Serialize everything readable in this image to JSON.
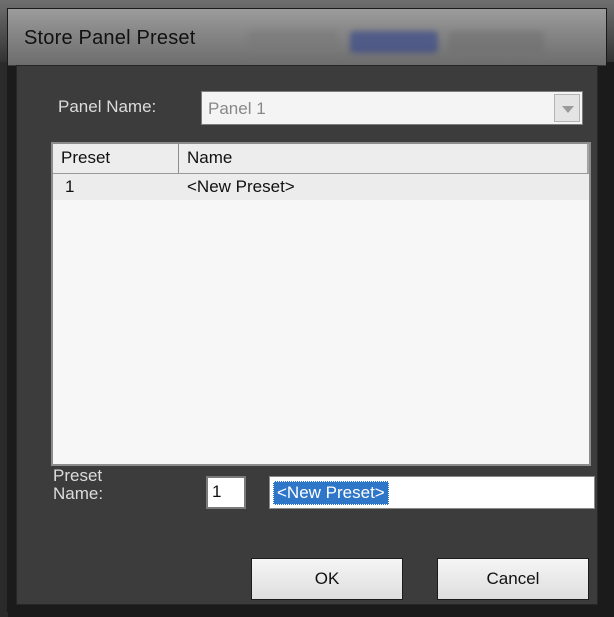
{
  "dialog": {
    "title": "Store Panel Preset"
  },
  "panel_name": {
    "label": "Panel Name:",
    "value": "Panel 1"
  },
  "list": {
    "columns": [
      "Preset",
      "Name"
    ],
    "rows": [
      {
        "preset": "1",
        "name": "<New Preset>"
      }
    ]
  },
  "preset_name": {
    "label_line1": "Preset",
    "label_line2": "Name:",
    "number": "1",
    "name": "<New Preset>"
  },
  "buttons": {
    "ok": "OK",
    "cancel": "Cancel"
  },
  "colors": {
    "client_bg": "#3c3c3c",
    "selection": "#2d76c8"
  }
}
